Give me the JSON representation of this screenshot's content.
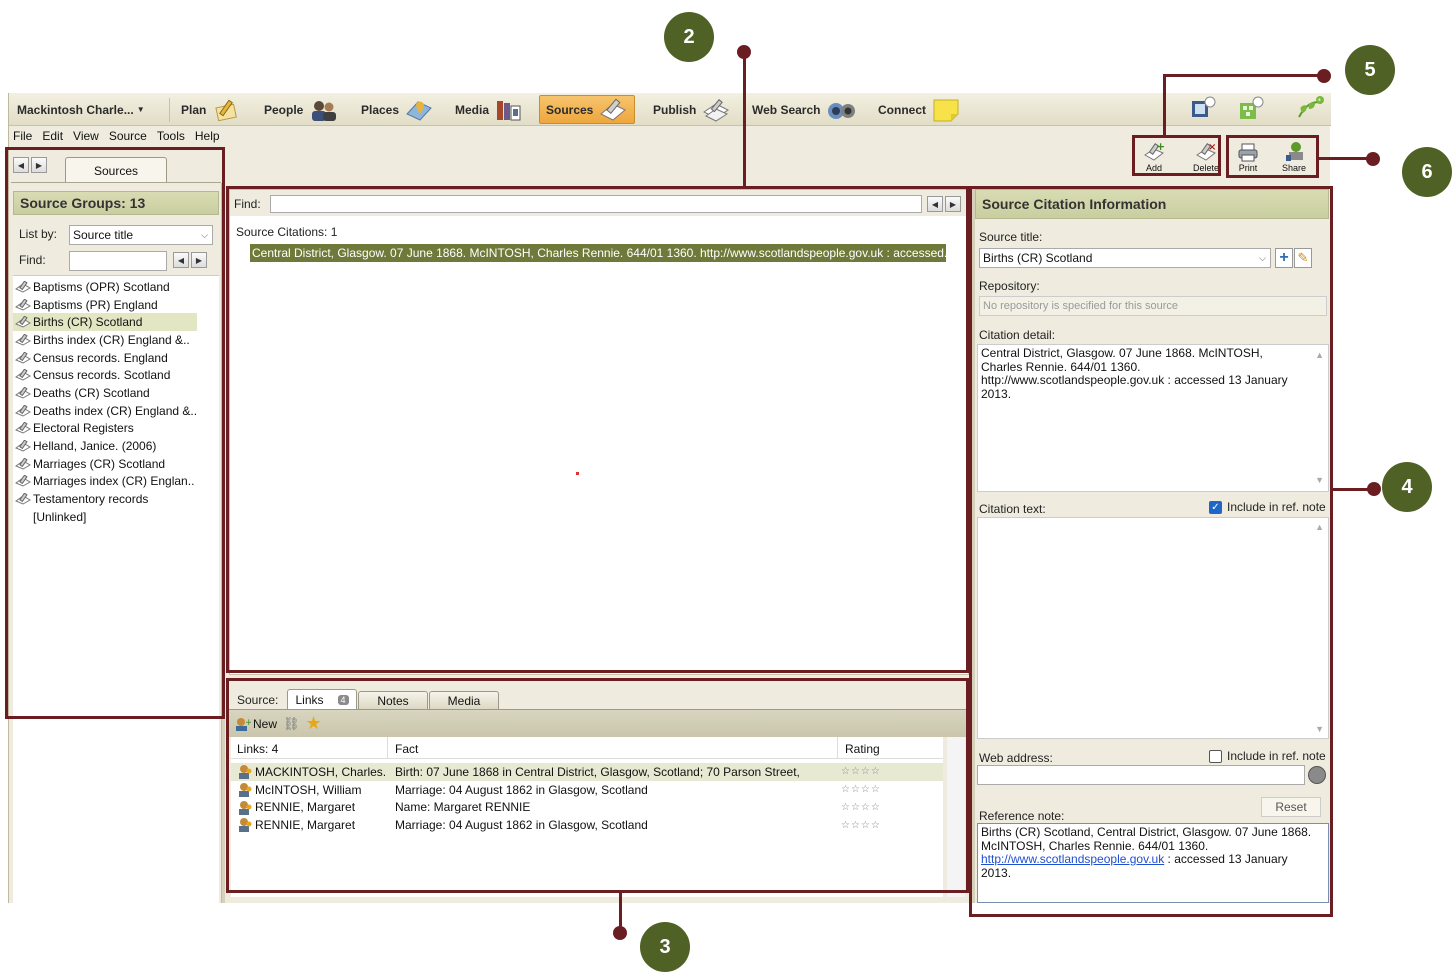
{
  "toolbar": {
    "file_dropdown": "Mackintosh Charle...",
    "workspaces": [
      {
        "label": "Plan",
        "icon": "pencil-paper-icon"
      },
      {
        "label": "People",
        "icon": "people-icon"
      },
      {
        "label": "Places",
        "icon": "map-pin-icon"
      },
      {
        "label": "Media",
        "icon": "media-books-icon"
      },
      {
        "label": "Sources",
        "icon": "source-book-icon"
      },
      {
        "label": "Publish",
        "icon": "publish-papers-icon"
      },
      {
        "label": "Web Search",
        "icon": "binoculars-icon"
      },
      {
        "label": "Connect",
        "icon": "sticky-note-icon"
      }
    ],
    "active_workspace": "Sources"
  },
  "menu": [
    "File",
    "Edit",
    "View",
    "Source",
    "Tools",
    "Help"
  ],
  "action_buttons": {
    "add": "Add",
    "delete": "Delete",
    "print": "Print",
    "share": "Share"
  },
  "left_panel": {
    "tab": "Sources",
    "header": "Source Groups: 13",
    "list_by_label": "List by:",
    "list_by_value": "Source title",
    "find_label": "Find:",
    "items": [
      "Baptisms (OPR) Scotland",
      "Baptisms (PR) England",
      "Births (CR) Scotland",
      "Births index (CR) England &..",
      "Census records. England",
      "Census records. Scotland",
      "Deaths (CR) Scotland",
      "Deaths index (CR) England &..",
      "Electoral Registers",
      "Helland, Janice. (2006)",
      "Marriages (CR) Scotland",
      "Marriages index (CR) Englan..",
      "Testamentory records",
      "[Unlinked]"
    ],
    "selected_index": 2
  },
  "center_panel": {
    "find_label": "Find:",
    "citations_count": "Source Citations: 1",
    "selected_citation": "Central District, Glasgow. 07 June 1868. McINTOSH, Charles Rennie. 644/01 1360. http://www.scotlandspeople.gov.uk : accessed..."
  },
  "bottom_panel": {
    "source_label": "Source:",
    "tabs": [
      "Links",
      "Notes",
      "Media"
    ],
    "links_badge": "4",
    "new_label": "New",
    "columns": [
      "Links: 4",
      "Fact",
      "Rating"
    ],
    "rows": [
      {
        "person": "MACKINTOSH, Charles...",
        "fact": "Birth: 07 June 1868 in Central District, Glasgow, Scotland; 70 Parson Street,",
        "rating": "☆☆☆☆"
      },
      {
        "person": "McINTOSH, William",
        "fact": "Marriage: 04 August 1862 in Glasgow, Scotland",
        "rating": "☆☆☆☆"
      },
      {
        "person": "RENNIE, Margaret",
        "fact": "Name: Margaret RENNIE",
        "rating": "☆☆☆☆"
      },
      {
        "person": "RENNIE, Margaret",
        "fact": "Marriage: 04 August 1862 in Glasgow, Scotland",
        "rating": "☆☆☆☆"
      }
    ]
  },
  "right_panel": {
    "header": "Source Citation Information",
    "source_title_label": "Source title:",
    "source_title_value": "Births (CR) Scotland",
    "repository_label": "Repository:",
    "repository_placeholder": "No repository is specified for this source",
    "citation_detail_label": "Citation detail:",
    "citation_detail_text": "Central District, Glasgow. 07 June 1868. McINTOSH, Charles Rennie. 644/01 1360. http://www.scotlandspeople.gov.uk : accessed 13 January 2013.",
    "citation_text_label": "Citation text:",
    "include_ref_note": "Include in ref. note",
    "web_address_label": "Web address:",
    "reference_note_label": "Reference note:",
    "reset_label": "Reset",
    "reference_note_text1": "Births (CR) Scotland, Central District, Glasgow. 07 June 1868. McINTOSH, Charles Rennie. 644/01 1360.",
    "reference_note_link": "http://www.scotlandspeople.gov.uk",
    "reference_note_text2": " : accessed 13 January 2013."
  },
  "callouts": [
    "2",
    "3",
    "4",
    "5",
    "6"
  ],
  "colors": {
    "accent_olive": "#6f7a3a",
    "callout_border": "#6b1e22",
    "badge_green": "#4f6124",
    "active_tab": "#eea63d"
  }
}
